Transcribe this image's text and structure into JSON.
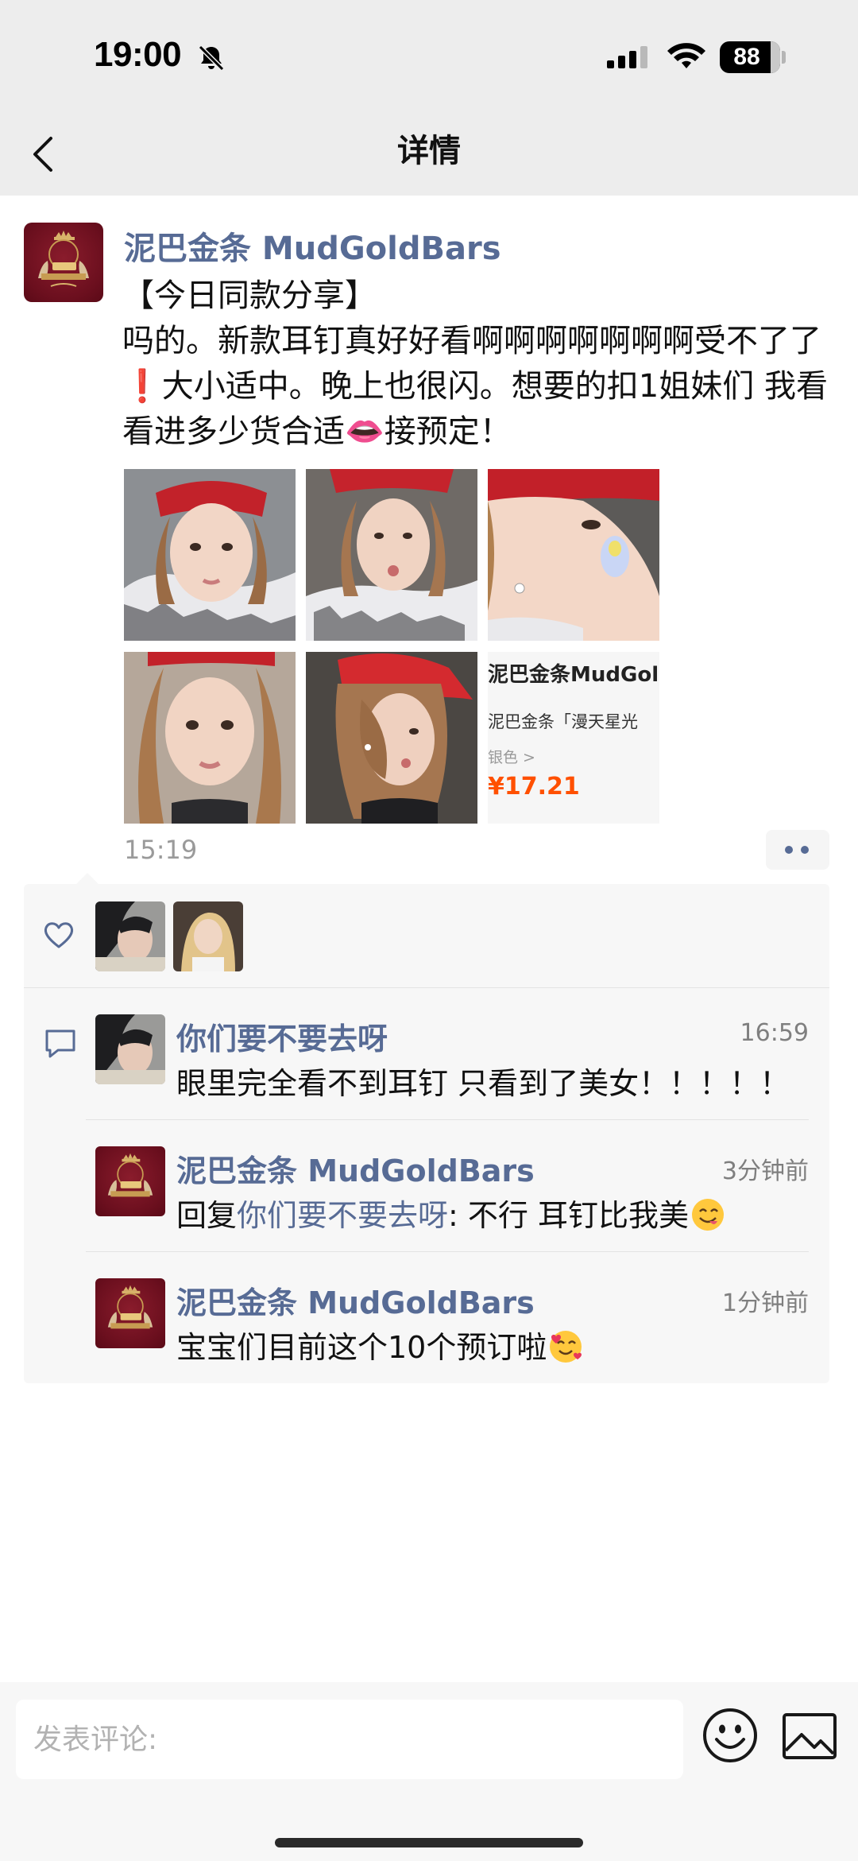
{
  "status_bar": {
    "time": "19:00",
    "battery": "88",
    "battery_level": 0.88,
    "icons": [
      "bell-slash-icon",
      "signal-icon",
      "wifi-icon",
      "battery-icon"
    ]
  },
  "nav": {
    "title": "详情",
    "back_icon": "chevron-left-icon"
  },
  "post": {
    "author": "泥巴金条 MudGoldBars",
    "text": "【今日同款分享】\n吗的。新款耳钉真好好看啊啊啊啊啊啊啊受不了了 ❗大小适中。晚上也很闪。想要的扣1姐妹们 我看看进多少货合适👄接预定！",
    "time": "15:19",
    "photo_count": 6,
    "product_card": {
      "title": "泥巴金条MudGoldBars",
      "subtitle": "泥巴金条「漫天星光",
      "option": "银色 >",
      "price": "¥17.21"
    }
  },
  "likes": {
    "icon": "heart-outline-icon",
    "count": 2
  },
  "comments": [
    {
      "name": "你们要不要去呀",
      "time": "16:59",
      "text": "眼里完全看不到耳钉 只看到了美女！！！！！"
    },
    {
      "name": "泥巴金条 MudGoldBars",
      "time": "3分钟前",
      "reply_prefix": "回复",
      "reply_to": "你们要不要去呀",
      "text": ": 不行 耳钉比我美"
    },
    {
      "name": "泥巴金条 MudGoldBars",
      "time": "1分钟前",
      "text": "宝宝们目前这个10个预订啦"
    }
  ],
  "bottom_bar": {
    "placeholder": "发表评论:",
    "emoji_icon": "smiley-icon",
    "image_icon": "image-icon"
  },
  "colors": {
    "link": "#576b95",
    "background_gray": "#ededed",
    "brand_red": "#6b0f1e"
  }
}
